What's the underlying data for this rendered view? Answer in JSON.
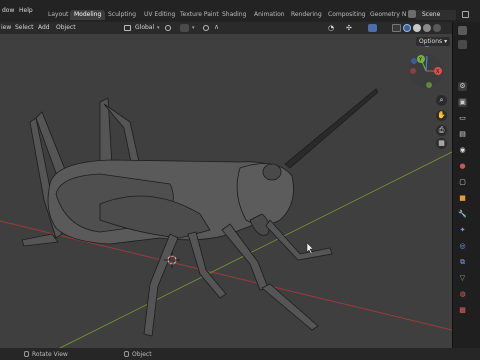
{
  "topbar": {
    "menus": [
      "dow",
      "Help"
    ],
    "workspaces": [
      "Layout",
      "Modeling",
      "Sculpting",
      "UV Editing",
      "Texture Paint",
      "Shading",
      "Animation",
      "Rendering",
      "Compositing",
      "Geometry N"
    ],
    "active_workspace": "Modeling",
    "scene": "Scene"
  },
  "header": {
    "view": "iew",
    "select": "Select",
    "add": "Add",
    "object": "Object",
    "orientation": "Global"
  },
  "viewport": {
    "options": "Options",
    "axes": {
      "x": "X",
      "y": "Y",
      "z": "Z"
    },
    "colors": {
      "background": "#3f3f3f",
      "x_axis": "#9b3b3b",
      "y_axis": "#6e8f2e",
      "wire": "#1a1a1a"
    }
  },
  "statusbar": {
    "left": "Rotate View",
    "middle": "Object"
  }
}
